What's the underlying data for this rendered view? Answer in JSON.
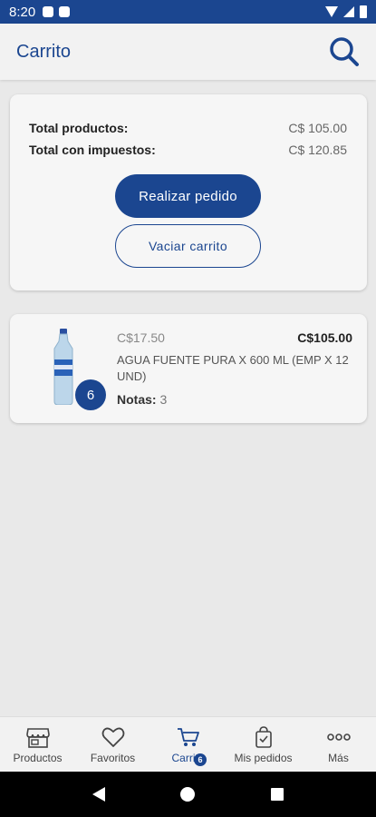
{
  "status_bar": {
    "time": "8:20"
  },
  "header": {
    "title": "Carrito"
  },
  "summary": {
    "products_label": "Total productos:",
    "products_value": "C$ 105.00",
    "taxes_label": "Total con impuestos:",
    "taxes_value": "C$ 120.85",
    "order_button": "Realizar pedido",
    "empty_button": "Vaciar carrito"
  },
  "cart_item": {
    "unit_price": "C$17.50",
    "total_price": "C$105.00",
    "name": "AGUA FUENTE PURA X 600 ML (EMP X 12 UND)",
    "notes_label": "Notas:",
    "notes_value": "3",
    "quantity": "6"
  },
  "bottom_nav": {
    "items": [
      {
        "label": "Productos",
        "icon": "store-icon"
      },
      {
        "label": "Favoritos",
        "icon": "heart-icon"
      },
      {
        "label": "Carrito",
        "icon": "cart-icon",
        "badge": "6"
      },
      {
        "label": "Mis pedidos",
        "icon": "shopping-bag-icon"
      },
      {
        "label": "Más",
        "icon": "more-icon"
      }
    ]
  },
  "colors": {
    "primary": "#1b4690",
    "background": "#e9e9e9",
    "card": "#f6f6f6"
  }
}
